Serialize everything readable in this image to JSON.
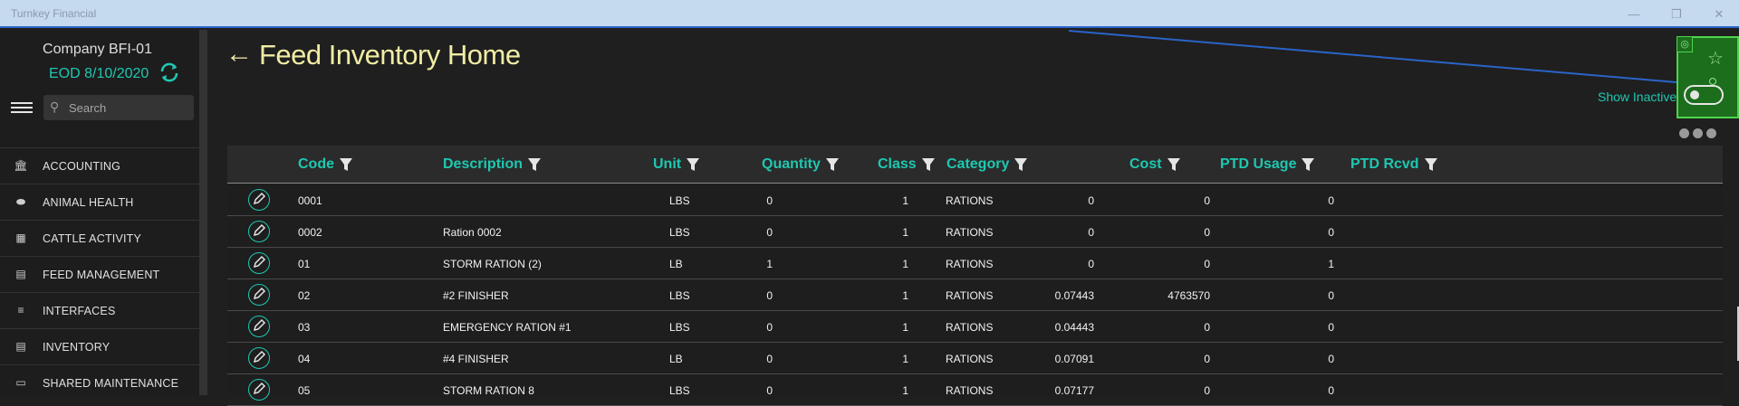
{
  "window": {
    "title": "Turnkey Financial"
  },
  "sidebar": {
    "company": "Company BFI-01",
    "eod": "EOD 8/10/2020",
    "search_placeholder": "Search",
    "items": [
      {
        "label": "ACCOUNTING",
        "icon": "bank-icon"
      },
      {
        "label": "ANIMAL HEALTH",
        "icon": "pill-icon"
      },
      {
        "label": "CATTLE ACTIVITY",
        "icon": "fence-icon"
      },
      {
        "label": "FEED MANAGEMENT",
        "icon": "feed-icon"
      },
      {
        "label": "INTERFACES",
        "icon": "sliders-icon"
      },
      {
        "label": "INVENTORY",
        "icon": "clipboard-icon"
      },
      {
        "label": "SHARED MAINTENANCE",
        "icon": "folder-icon"
      }
    ]
  },
  "main": {
    "title": "Feed Inventory Home",
    "show_inactive_label": "Show Inactive",
    "show_inactive": false
  },
  "grid": {
    "columns": [
      "Code",
      "Description",
      "Unit",
      "Quantity",
      "Class",
      "Category",
      "Cost",
      "PTD Usage",
      "PTD Rcvd"
    ],
    "rows": [
      {
        "code": "0001",
        "description": "",
        "unit": "LBS",
        "quantity": "0",
        "class": "1",
        "category": "RATIONS",
        "cost": "0",
        "ptd_usage": "0",
        "ptd_rcvd": "0"
      },
      {
        "code": "0002",
        "description": "Ration 0002",
        "unit": "LBS",
        "quantity": "0",
        "class": "1",
        "category": "RATIONS",
        "cost": "0",
        "ptd_usage": "0",
        "ptd_rcvd": "0"
      },
      {
        "code": "01",
        "description": "STORM RATION (2)",
        "unit": "LB",
        "quantity": "1",
        "class": "1",
        "category": "RATIONS",
        "cost": "0",
        "ptd_usage": "0",
        "ptd_rcvd": "1"
      },
      {
        "code": "02",
        "description": "#2 FINISHER",
        "unit": "LBS",
        "quantity": "0",
        "class": "1",
        "category": "RATIONS",
        "cost": "0.07443",
        "ptd_usage": "4763570",
        "ptd_rcvd": "0"
      },
      {
        "code": "03",
        "description": "EMERGENCY RATION #1",
        "unit": "LBS",
        "quantity": "0",
        "class": "1",
        "category": "RATIONS",
        "cost": "0.04443",
        "ptd_usage": "0",
        "ptd_rcvd": "0"
      },
      {
        "code": "04",
        "description": "#4 FINISHER",
        "unit": "LB",
        "quantity": "0",
        "class": "1",
        "category": "RATIONS",
        "cost": "0.07091",
        "ptd_usage": "0",
        "ptd_rcvd": "0"
      },
      {
        "code": "05",
        "description": "STORM RATION 8",
        "unit": "LBS",
        "quantity": "0",
        "class": "1",
        "category": "RATIONS",
        "cost": "0.07177",
        "ptd_usage": "0",
        "ptd_rcvd": "0"
      }
    ]
  },
  "colors": {
    "accent": "#1ec8b1",
    "title": "#f0eca5",
    "highlight": "#4fd44f"
  }
}
